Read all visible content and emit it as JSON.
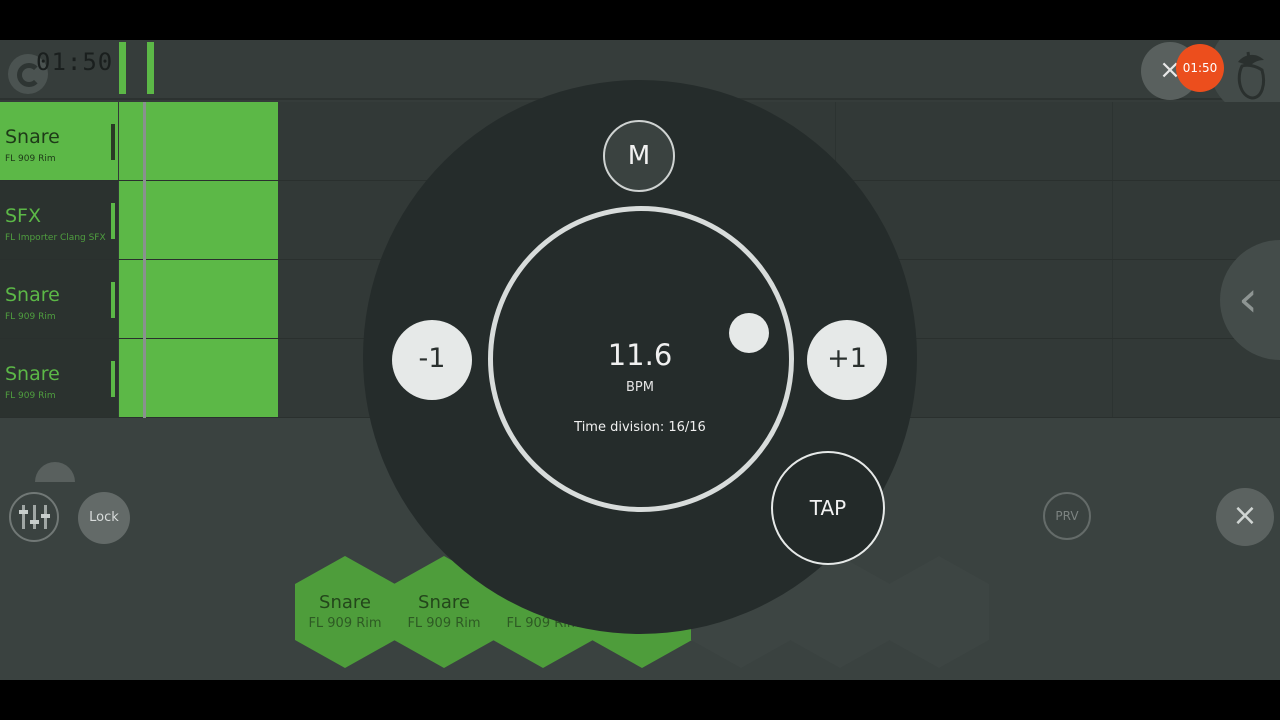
{
  "header": {
    "time_display": "01:50",
    "recording_badge": "01:50"
  },
  "channels": [
    {
      "name": "Snare",
      "sample": "FL 909 Rim",
      "active": true
    },
    {
      "name": "SFX",
      "sample": "FL Importer Clang SFX",
      "active": false
    },
    {
      "name": "Snare",
      "sample": "FL 909 Rim",
      "active": false
    },
    {
      "name": "Snare",
      "sample": "FL 909 Rim",
      "active": false
    }
  ],
  "bottom": {
    "lock_label": "Lock",
    "preview_label": "PRV"
  },
  "pads": [
    {
      "name": "Snare",
      "sample": "FL 909 Rim"
    },
    {
      "name": "Snare",
      "sample": "FL 909 Rim"
    },
    {
      "name": "",
      "sample": "FL 909 Rim"
    }
  ],
  "tempo_dialog": {
    "metronome_label": "M",
    "bpm_value": "11.6",
    "bpm_unit": "BPM",
    "time_division": "Time division: 16/16",
    "decrement_label": "-1",
    "increment_label": "+1",
    "tap_label": "TAP"
  },
  "icons": {
    "logo": "fl-logo-icon",
    "close": "close-icon",
    "fruit": "fruit-icon",
    "back": "chevron-left-icon",
    "mixer": "mixer-sliders-icon"
  },
  "colors": {
    "accent_green": "#5cb847",
    "record_orange": "#ec4e1d",
    "background": "#353c3a",
    "dial_background": "#252c2b"
  }
}
